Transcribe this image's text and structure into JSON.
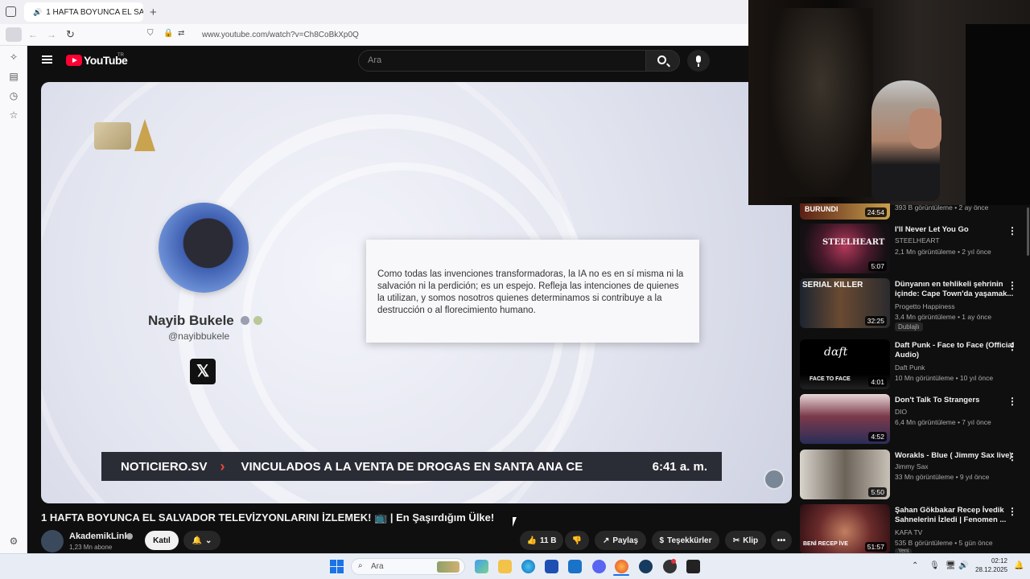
{
  "browser": {
    "tab_title": "1 HAFTA BOYUNCA EL SALV",
    "new_tab": "+",
    "url": "www.youtube.com/watch?v=Ch8CoBkXp0Q"
  },
  "youtube": {
    "logo": "YouTube",
    "country": "TR",
    "search_placeholder": "Ara"
  },
  "player": {
    "profile_name": "Nayib Bukele",
    "profile_handle": "@nayibbukele",
    "quote": "Como todas las invenciones transformadoras, la IA no es en sí misma ni la salvación ni la perdición; es un espejo. Refleja las intenciones de quienes la utilizan, y somos nosotros quienes determinamos si contribuye a la destrucción o al florecimiento humano.",
    "ticker_source": "NOTICIERO.SV",
    "ticker_text": "VINCULADOS A LA VENTA DE DROGAS EN SANTA ANA CE",
    "ticker_time": "6:41 a. m."
  },
  "video": {
    "title": "1 HAFTA BOYUNCA EL SALVADOR TELEVİZYONLARINI İZLEMEK! 📺 | En Şaşırdığım Ülke!",
    "channel": "AkademikLink",
    "subscribers": "1,23 Mn abone",
    "join_label": "Katıl",
    "likes": "11 B",
    "share_label": "Paylaş",
    "thanks_label": "Teşekkürler",
    "clip_label": "Klip"
  },
  "recommendations": [
    {
      "title": "",
      "channel": "",
      "meta": "393 B görüntüleme • 2 ay önce",
      "duration": "24:54",
      "thumb_text": "BURUNDI"
    },
    {
      "title": "I'll Never Let You Go",
      "channel": "STEELHEART",
      "meta": "2,1 Mn görüntüleme • 2 yıl önce",
      "duration": "5:07",
      "thumb_text": "STEELHEART"
    },
    {
      "title": "Dünyanın en tehlikeli şehrinin içinde: Cape Town'da yaşamak...",
      "channel": "Progetto Happiness",
      "meta": "3,4 Mn görüntüleme • 1 ay önce",
      "badge": "Dublajlı",
      "duration": "32:25",
      "thumb_text": "SERIAL KILLER"
    },
    {
      "title": "Daft Punk - Face to Face (Official Audio)",
      "channel": "Daft Punk",
      "meta": "10 Mn görüntüleme • 10 yıl önce",
      "duration": "4:01",
      "thumb_text": "FACE TO FACE"
    },
    {
      "title": "Don't Talk To Strangers",
      "channel": "DIO",
      "meta": "6,4 Mn görüntüleme • 7 yıl önce",
      "duration": "4:52",
      "thumb_text": ""
    },
    {
      "title": "Worakls - Blue ( Jimmy Sax live)",
      "channel": "Jimmy Sax",
      "meta": "33 Mn görüntüleme • 9 yıl önce",
      "duration": "5:50",
      "thumb_text": ""
    },
    {
      "title": "Şahan Gökbakar Recep İvedik Sahnelerini İzledi | Fenomen ...",
      "channel": "KAFA TV",
      "meta": "535 B görüntüleme • 5 gün önce",
      "badge": "Yeni",
      "duration": "51:57",
      "thumb_text": "BENİ RECEP İVE"
    }
  ],
  "taskbar": {
    "search_placeholder": "Ara",
    "time": "02:12",
    "date": "28.12.2025"
  }
}
